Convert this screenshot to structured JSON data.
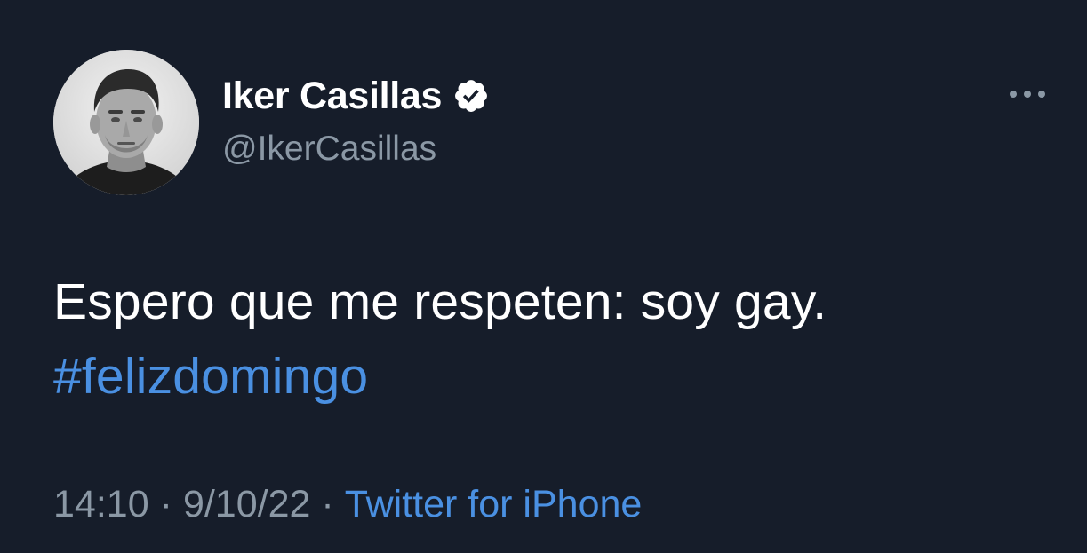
{
  "colors": {
    "background": "#161d2a",
    "text_primary": "#ffffff",
    "text_secondary": "#8b98a5",
    "link": "#4a90e2"
  },
  "author": {
    "display_name": "Iker Casillas",
    "handle": "@IkerCasillas",
    "verified_icon": "verified-badge-icon",
    "avatar_icon": "profile-photo"
  },
  "menu": {
    "icon": "more-options-icon"
  },
  "tweet": {
    "text": "Espero que me respeten: soy gay.",
    "hashtag": "#felizdomingo"
  },
  "meta": {
    "time": "14:10",
    "separator": "·",
    "date": "9/10/22",
    "source": "Twitter for iPhone"
  }
}
